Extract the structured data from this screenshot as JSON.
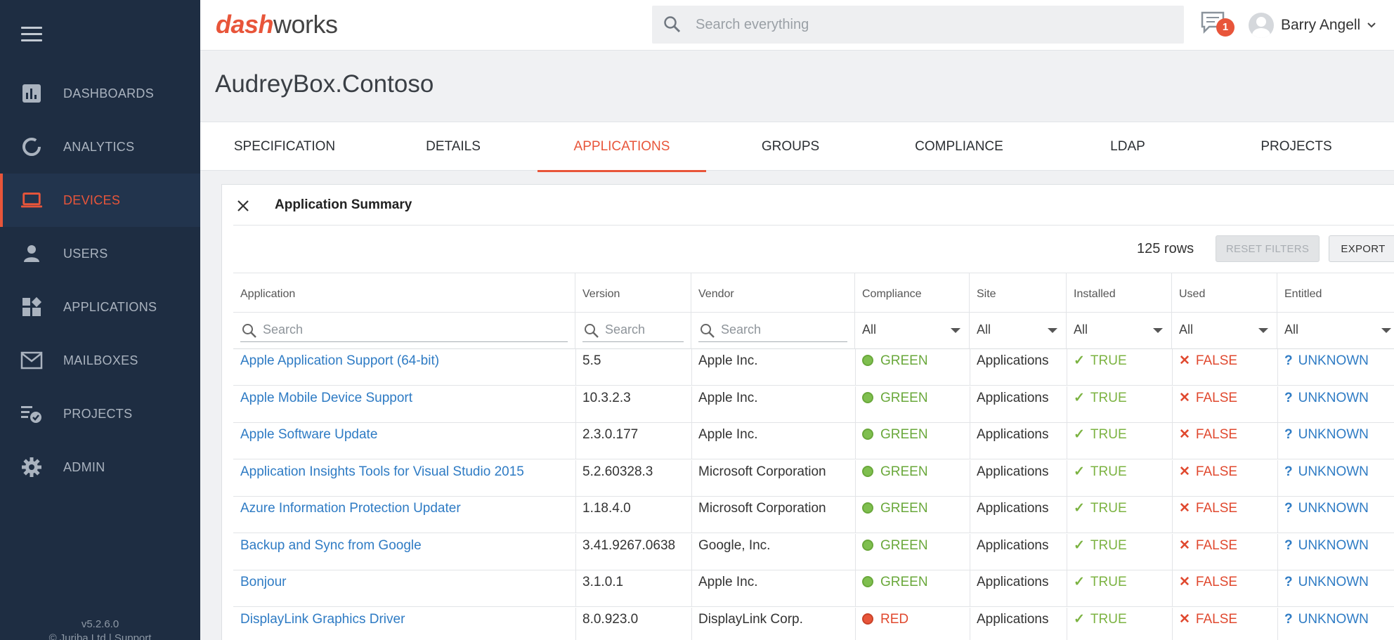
{
  "sidebar": {
    "items": [
      {
        "label": "DASHBOARDS",
        "icon": "bar-chart-icon"
      },
      {
        "label": "ANALYTICS",
        "icon": "pie-ring-icon"
      },
      {
        "label": "DEVICES",
        "icon": "laptop-icon",
        "active": true
      },
      {
        "label": "USERS",
        "icon": "person-icon"
      },
      {
        "label": "APPLICATIONS",
        "icon": "apps-grid-icon"
      },
      {
        "label": "MAILBOXES",
        "icon": "envelope-icon"
      },
      {
        "label": "PROJECTS",
        "icon": "checklist-icon"
      },
      {
        "label": "ADMIN",
        "icon": "gear-icon"
      }
    ],
    "version": "v5.2.6.0",
    "copyright": "© Juriba Ltd | Support"
  },
  "header": {
    "logo_part1": "dash",
    "logo_part2": "works",
    "search_placeholder": "Search everything",
    "notification_count": "1",
    "user_name": "Barry Angell"
  },
  "page": {
    "title": "AudreyBox.Contoso",
    "tabs": [
      "SPECIFICATION",
      "DETAILS",
      "APPLICATIONS",
      "GROUPS",
      "COMPLIANCE",
      "LDAP",
      "PROJECTS"
    ],
    "active_tab": "APPLICATIONS"
  },
  "panel": {
    "title": "Application Summary",
    "rows_count": "125 rows",
    "reset_label": "RESET FILTERS",
    "export_label": "EXPORT"
  },
  "grid": {
    "columns": [
      "Application",
      "Version",
      "Vendor",
      "Compliance",
      "Site",
      "Installed",
      "Used",
      "Entitled"
    ],
    "search_placeholder": "Search",
    "select_default": "All",
    "rows": [
      {
        "application": "Apple Application Support (64-bit)",
        "version": "5.5",
        "vendor": "Apple Inc.",
        "compliance": "GREEN",
        "site": "Applications",
        "installed": "TRUE",
        "used": "FALSE",
        "entitled": "UNKNOWN"
      },
      {
        "application": "Apple Mobile Device Support",
        "version": "10.3.2.3",
        "vendor": "Apple Inc.",
        "compliance": "GREEN",
        "site": "Applications",
        "installed": "TRUE",
        "used": "FALSE",
        "entitled": "UNKNOWN"
      },
      {
        "application": "Apple Software Update",
        "version": "2.3.0.177",
        "vendor": "Apple Inc.",
        "compliance": "GREEN",
        "site": "Applications",
        "installed": "TRUE",
        "used": "FALSE",
        "entitled": "UNKNOWN"
      },
      {
        "application": "Application Insights Tools for Visual Studio 2015",
        "version": "5.2.60328.3",
        "vendor": "Microsoft Corporation",
        "compliance": "GREEN",
        "site": "Applications",
        "installed": "TRUE",
        "used": "FALSE",
        "entitled": "UNKNOWN"
      },
      {
        "application": "Azure Information Protection Updater",
        "version": "1.18.4.0",
        "vendor": "Microsoft Corporation",
        "compliance": "GREEN",
        "site": "Applications",
        "installed": "TRUE",
        "used": "FALSE",
        "entitled": "UNKNOWN"
      },
      {
        "application": "Backup and Sync from Google",
        "version": "3.41.9267.0638",
        "vendor": "Google, Inc.",
        "compliance": "GREEN",
        "site": "Applications",
        "installed": "TRUE",
        "used": "FALSE",
        "entitled": "UNKNOWN"
      },
      {
        "application": "Bonjour",
        "version": "3.1.0.1",
        "vendor": "Apple Inc.",
        "compliance": "GREEN",
        "site": "Applications",
        "installed": "TRUE",
        "used": "FALSE",
        "entitled": "UNKNOWN"
      },
      {
        "application": "DisplayLink Graphics Driver",
        "version": "8.0.923.0",
        "vendor": "DisplayLink Corp.",
        "compliance": "RED",
        "site": "Applications",
        "installed": "TRUE",
        "used": "FALSE",
        "entitled": "UNKNOWN"
      }
    ]
  },
  "colors": {
    "accent": "#e8553a",
    "sidebar_bg": "#1e2d42",
    "link": "#2e7bc4",
    "true_green": "#7cb342",
    "false_red": "#e0492f"
  }
}
